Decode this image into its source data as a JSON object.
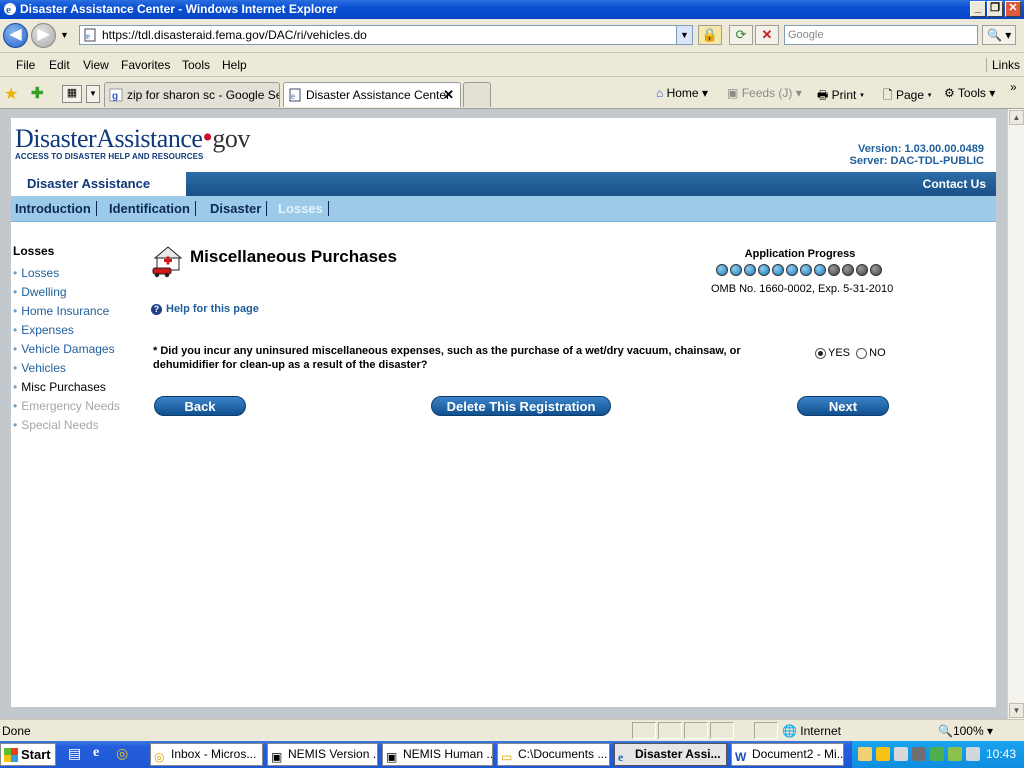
{
  "window": {
    "title": "Disaster Assistance Center - Windows Internet Explorer"
  },
  "address": {
    "url": "https://tdl.disasteraid.fema.gov/DAC/ri/vehicles.do",
    "search_placeholder": "Google"
  },
  "menu": {
    "items": [
      "File",
      "Edit",
      "View",
      "Favorites",
      "Tools",
      "Help"
    ],
    "links_label": "Links"
  },
  "tabs": [
    {
      "label": "zip for sharon sc - Google Se..."
    },
    {
      "label": "Disaster Assistance Center"
    }
  ],
  "commands": {
    "home": "Home",
    "feeds": "Feeds (J)",
    "print": "Print",
    "page": "Page",
    "tools": "Tools"
  },
  "site": {
    "logo_main": "DisasterAssistance",
    "logo_gov": "gov",
    "logo_tagline": "ACCESS TO DISASTER HELP AND RESOURCES",
    "version": "Version: 1.03.00.00.0489",
    "server": "Server: DAC-TDL-PUBLIC",
    "section_label": "Disaster Assistance",
    "contact": "Contact Us"
  },
  "nav": {
    "items": [
      "Introduction",
      "Identification",
      "Disaster",
      "Losses"
    ]
  },
  "sidebar": {
    "heading": "Losses",
    "items": [
      {
        "label": "Losses",
        "state": "link"
      },
      {
        "label": "Dwelling",
        "state": "link"
      },
      {
        "label": "Home Insurance",
        "state": "link"
      },
      {
        "label": "Expenses",
        "state": "link"
      },
      {
        "label": "Vehicle Damages",
        "state": "link"
      },
      {
        "label": "Vehicles",
        "state": "link"
      },
      {
        "label": "Misc Purchases",
        "state": "current"
      },
      {
        "label": "Emergency Needs",
        "state": "disabled"
      },
      {
        "label": "Special Needs",
        "state": "disabled"
      }
    ]
  },
  "main": {
    "title": "Miscellaneous Purchases",
    "progress_title": "Application Progress",
    "progress_completed": 8,
    "progress_total": 12,
    "omb": "OMB No. 1660-0002, Exp. 5-31-2010",
    "help": "Help for this page",
    "question": "* Did you incur any uninsured miscellaneous expenses, such as the purchase of a wet/dry vacuum, chainsaw, or dehumidifier for clean-up as a result of the disaster?",
    "yes": "YES",
    "no": "NO",
    "selected": "YES",
    "back": "Back",
    "delete": "Delete This Registration",
    "next": "Next"
  },
  "statusbar": {
    "status": "Done",
    "zone": "Internet",
    "zoom": "100%"
  },
  "taskbar": {
    "start": "Start",
    "buttons": [
      {
        "label": "Inbox - Micros..."
      },
      {
        "label": "NEMIS Version ..."
      },
      {
        "label": "NEMIS Human ..."
      },
      {
        "label": "C:\\Documents ..."
      },
      {
        "label": "Disaster Assi..."
      },
      {
        "label": "Document2 - Mi..."
      }
    ],
    "clock": "10:43"
  },
  "colors": {
    "brand_blue": "#1a4f86",
    "nav_light_blue": "#9ccae8",
    "progress_on": "#1a78b8",
    "progress_off": "#444444"
  }
}
